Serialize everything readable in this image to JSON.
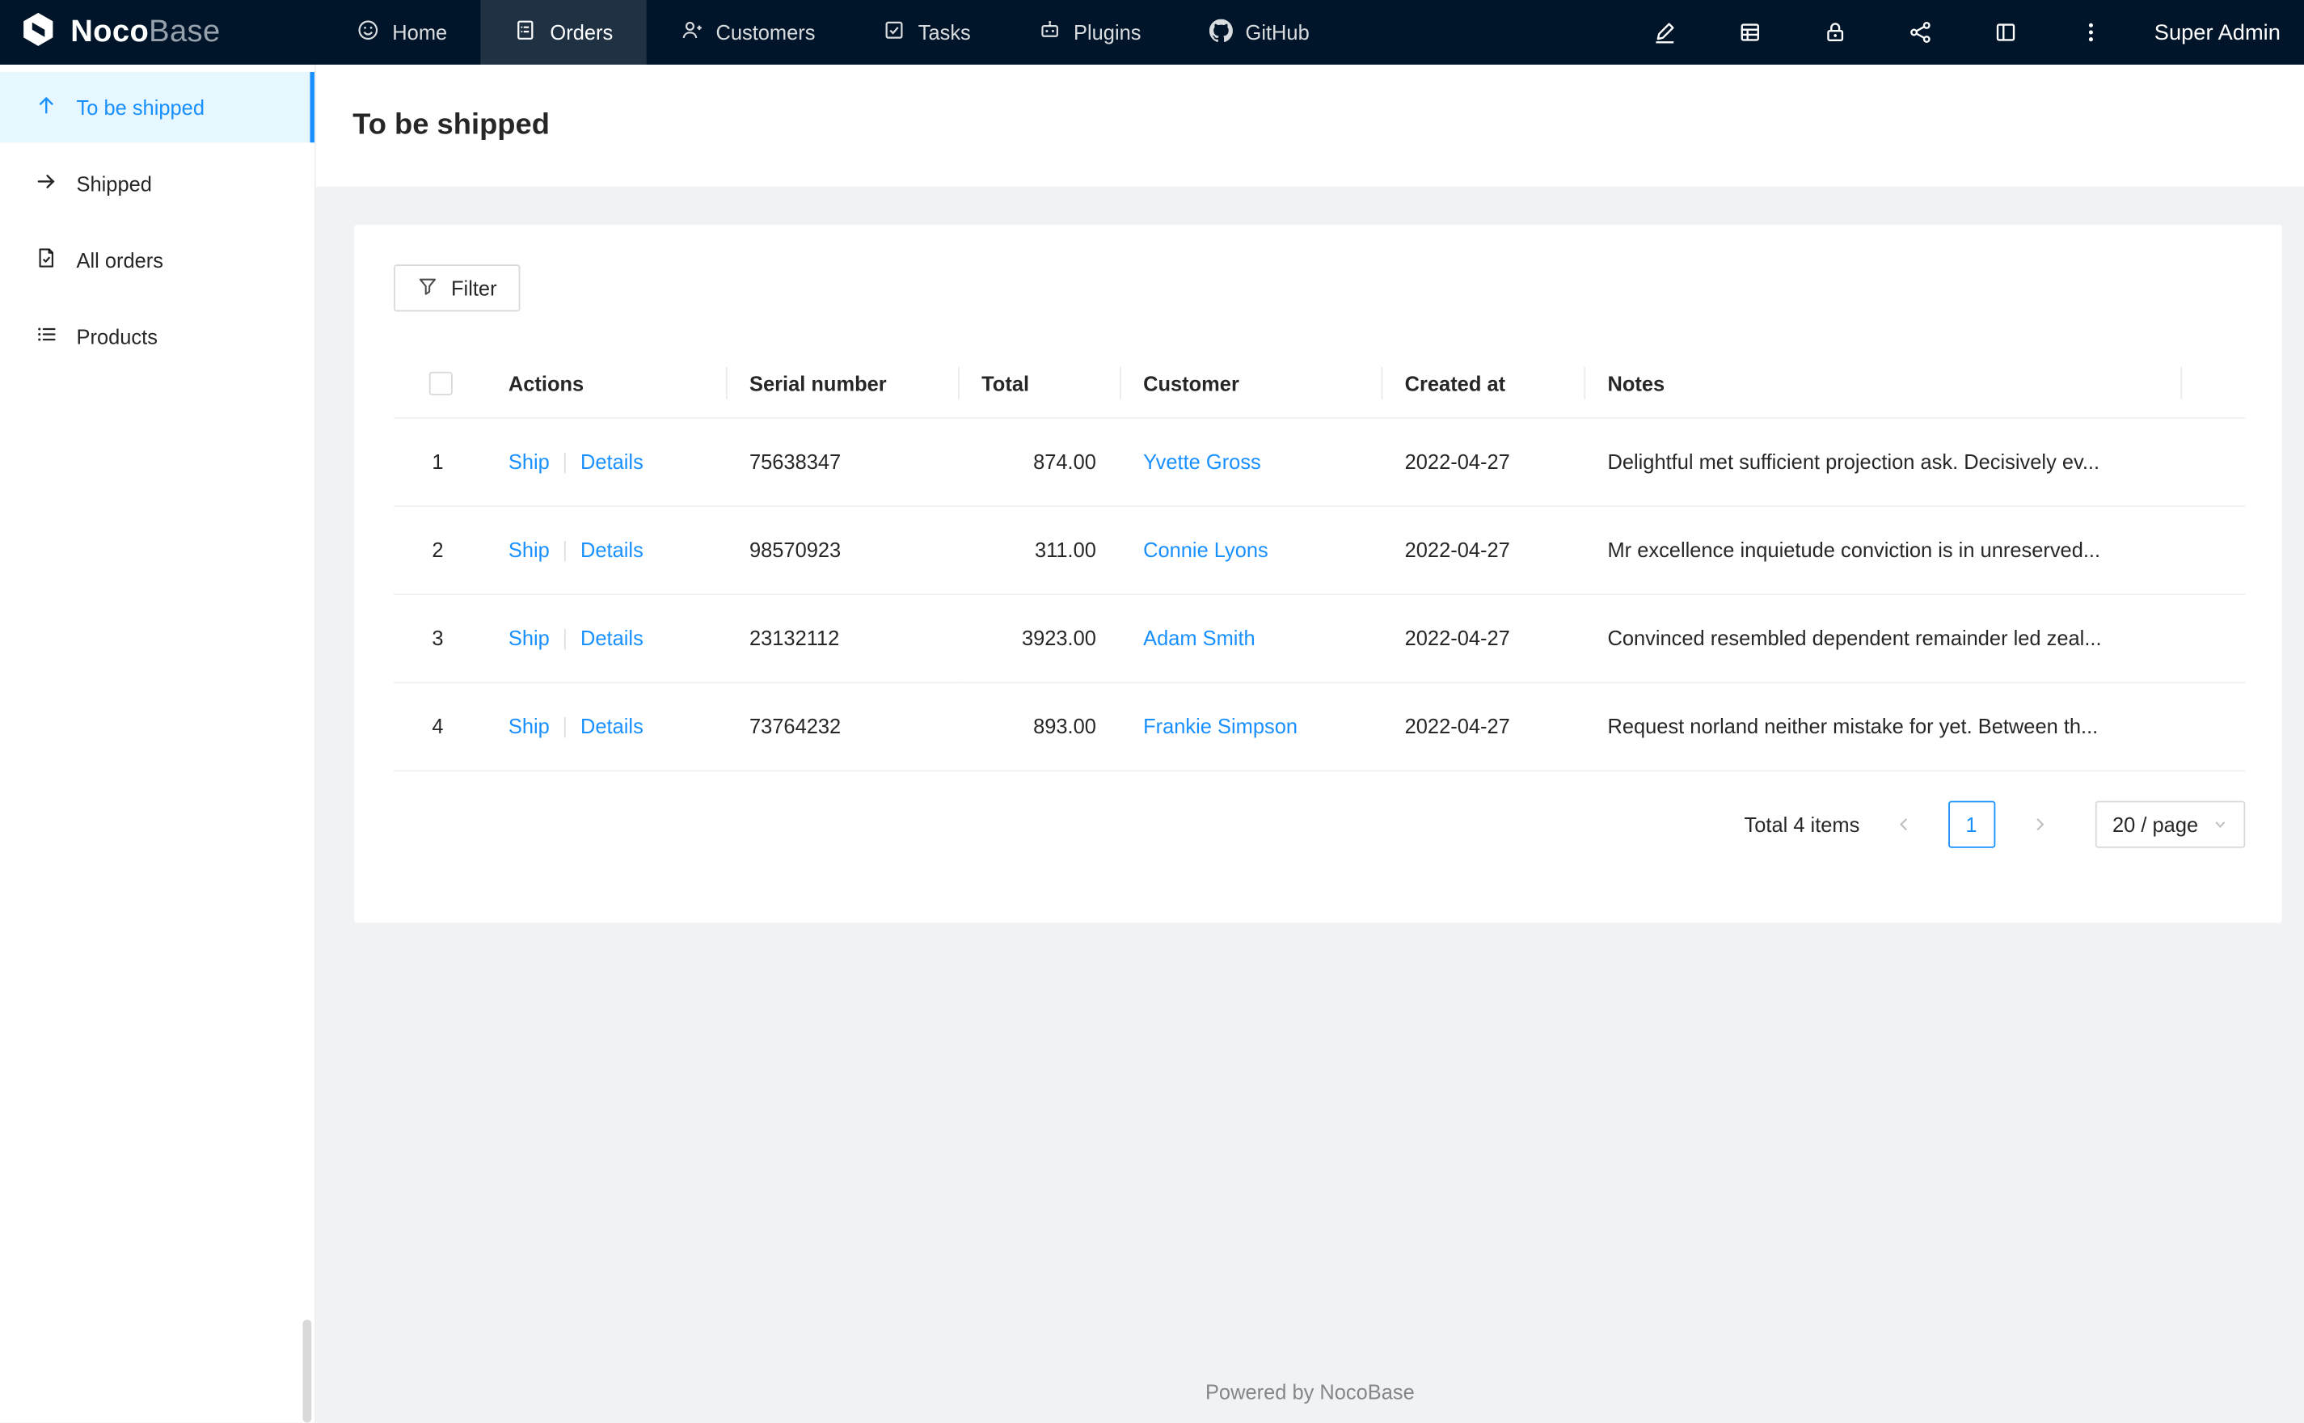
{
  "topbar": {
    "logo_text_bold": "Noco",
    "logo_text_light": "Base",
    "nav": [
      {
        "label": "Home",
        "icon": "smile-icon",
        "active": false
      },
      {
        "label": "Orders",
        "icon": "orders-icon",
        "active": true
      },
      {
        "label": "Customers",
        "icon": "user-add-icon",
        "active": false
      },
      {
        "label": "Tasks",
        "icon": "check-square-icon",
        "active": false
      },
      {
        "label": "Plugins",
        "icon": "robot-icon",
        "active": false
      },
      {
        "label": "GitHub",
        "icon": "github-icon",
        "active": false
      }
    ],
    "action_icons": [
      "highlighter-icon",
      "database-icon",
      "lock-icon",
      "share-alt-icon",
      "layout-icon",
      "more-icon"
    ],
    "user_name": "Super Admin"
  },
  "sidebar": {
    "items": [
      {
        "label": "To be shipped",
        "icon": "arrow-up-icon",
        "active": true
      },
      {
        "label": "Shipped",
        "icon": "arrow-right-icon",
        "active": false
      },
      {
        "label": "All orders",
        "icon": "file-done-icon",
        "active": false
      },
      {
        "label": "Products",
        "icon": "unordered-list-icon",
        "active": false
      }
    ]
  },
  "page": {
    "title": "To be shipped"
  },
  "toolbar": {
    "filter_label": "Filter"
  },
  "table": {
    "columns": [
      "Actions",
      "Serial number",
      "Total",
      "Customer",
      "Created at",
      "Notes"
    ],
    "row_actions": {
      "ship": "Ship",
      "details": "Details"
    },
    "rows": [
      {
        "index": "1",
        "serial": "75638347",
        "total": "874.00",
        "customer": "Yvette Gross",
        "created_at": "2022-04-27",
        "notes": "Delightful met sufficient projection ask. Decisively ev..."
      },
      {
        "index": "2",
        "serial": "98570923",
        "total": "311.00",
        "customer": "Connie Lyons",
        "created_at": "2022-04-27",
        "notes": "Mr excellence inquietude conviction is in unreserved..."
      },
      {
        "index": "3",
        "serial": "23132112",
        "total": "3923.00",
        "customer": "Adam Smith",
        "created_at": "2022-04-27",
        "notes": "Convinced resembled dependent remainder led zeal..."
      },
      {
        "index": "4",
        "serial": "73764232",
        "total": "893.00",
        "customer": "Frankie Simpson",
        "created_at": "2022-04-27",
        "notes": "Request norland neither mistake for yet. Between th..."
      }
    ]
  },
  "pagination": {
    "total_text": "Total 4 items",
    "current_page": "1",
    "page_size": "20 / page"
  },
  "footer": {
    "text": "Powered by NocoBase"
  },
  "colors": {
    "accent": "#1890ff",
    "topbar_bg": "#001529",
    "sidebar_active_bg": "#e6f7ff",
    "content_bg": "#f0f2f5"
  }
}
